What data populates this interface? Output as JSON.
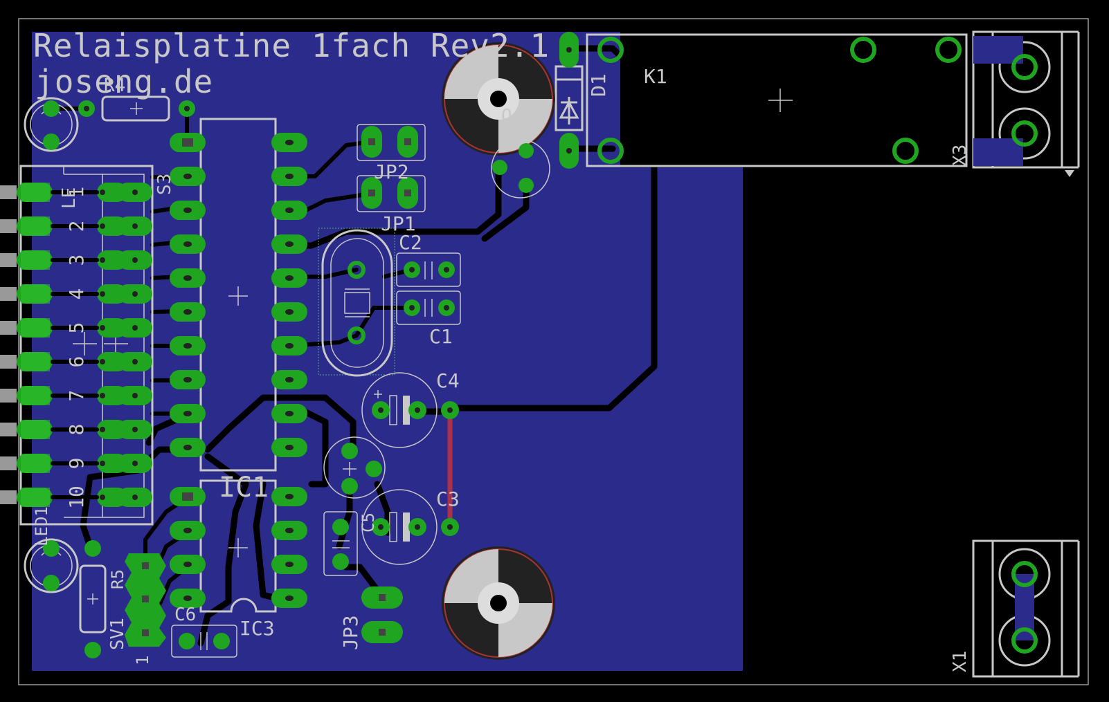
{
  "board": {
    "title_line1": "Relaisplatine 1fach Rev2.1",
    "title_line2": "joseng.de"
  },
  "labels": {
    "k1": "K1",
    "d1": "D1",
    "x1": "X1",
    "x3": "X3",
    "ic1": "IC1",
    "ic3": "IC3",
    "jp1": "JP1",
    "jp2": "JP2",
    "jp3": "JP3",
    "c1": "C1",
    "c2": "C2",
    "c3": "C3",
    "c4": "C4",
    "c5": "C5",
    "c6": "C6",
    "r4": "R4",
    "r5": "R5",
    "s3": "S3",
    "sv1": "SV1",
    "q1": "Q",
    "led1": "LED1",
    "led": "LE",
    "sv1_pin": "1"
  },
  "dip_numbers": [
    "1",
    "2",
    "3",
    "4",
    "5",
    "6",
    "7",
    "8",
    "9",
    "10"
  ],
  "colors": {
    "background": "#000000",
    "copper_fill": "#2b2b8c",
    "pad": "#1fa51f",
    "silkscreen": "#c8c8c8",
    "wire_bridge": "#a8324a"
  }
}
